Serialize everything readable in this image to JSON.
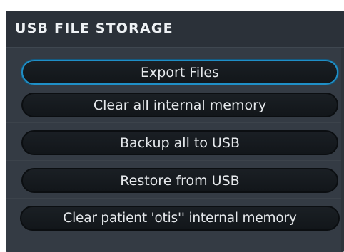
{
  "panel": {
    "title": "USB FILE STORAGE"
  },
  "buttons": [
    {
      "label": "Export Files",
      "selected": true
    },
    {
      "label": "Clear all internal memory",
      "selected": false
    },
    {
      "label": "Backup all to USB",
      "selected": false
    },
    {
      "label": "Restore from USB",
      "selected": false
    },
    {
      "label": "Clear patient 'otis'' internal memory",
      "selected": false
    }
  ],
  "colors": {
    "panel_bg": "#343b44",
    "header_bg": "#2b3139",
    "button_bg": "#161b20",
    "selected_border": "#1f8fc7",
    "text": "#e6e9ec"
  }
}
